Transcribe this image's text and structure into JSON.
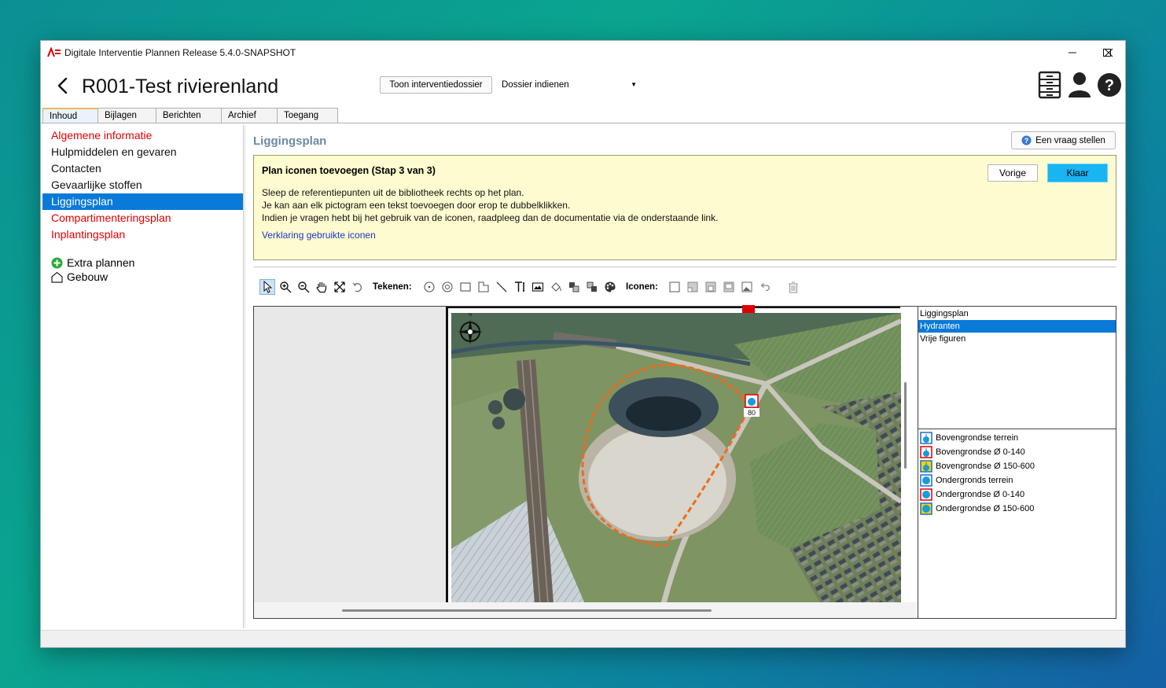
{
  "window": {
    "title": "Digitale Interventie Plannen Release 5.4.0-SNAPSHOT",
    "controls": [
      "minimize-icon",
      "maximize-icon",
      "close-icon"
    ]
  },
  "header": {
    "dossier_title": "R001-Test rivierenland",
    "toon_button": "Toon interventiedossier",
    "dossier_select": {
      "selected": "Dossier indienen"
    },
    "icons": [
      "cabinet-icon",
      "user-icon",
      "help-icon"
    ]
  },
  "tabs": [
    "Inhoud",
    "Bijlagen",
    "Berichten",
    "Archief",
    "Toegang"
  ],
  "active_tab": "Inhoud",
  "sidebar": {
    "items": [
      {
        "label": "Algemene informatie",
        "state": "incomplete"
      },
      {
        "label": "Hulpmiddelen en gevaren",
        "state": "complete"
      },
      {
        "label": "Contacten",
        "state": "complete"
      },
      {
        "label": "Gevaarlijke stoffen",
        "state": "complete"
      },
      {
        "label": "Liggingsplan",
        "state": "active"
      },
      {
        "label": "Compartimenteringsplan",
        "state": "incomplete"
      },
      {
        "label": "Inplantingsplan",
        "state": "incomplete"
      }
    ],
    "extra_plans": "Extra plannen",
    "building": "Gebouw"
  },
  "main": {
    "section_title": "Liggingsplan",
    "ask_button": "Een vraag stellen",
    "step": {
      "title": "Plan iconen toevoegen (Stap 3 van 3)",
      "lines": [
        "Sleep de referentiepunten uit de bibliotheek rechts op het plan.",
        "Je kan aan elk pictogram een tekst toevoegen door erop te dubbelklikken.",
        "Indien je vragen hebt bij het gebruik van de iconen, raadpleeg dan de documentatie via de onderstaande link."
      ],
      "link": "Verklaring gebruikte iconen",
      "prev_button": "Vorige",
      "done_button": "Klaar"
    },
    "toolbar": {
      "draw_label": "Tekenen:",
      "icons_label": "Iconen:"
    },
    "map": {
      "marker_label": "80",
      "north_label": "N"
    },
    "library": {
      "categories": [
        "Liggingsplan",
        "Hydranten",
        "Vrije figuren"
      ],
      "selected_category": "Hydranten",
      "icons": [
        {
          "label": "Bovengrondse terrein",
          "border": "#1a6fd0",
          "fill": "#ffffff"
        },
        {
          "label": "Bovengrondse Ø 0-140",
          "border": "#e00000",
          "fill": "#ffffff"
        },
        {
          "label": "Bovengrondse Ø 150-600",
          "border": "#1a6fd0",
          "fill": "#f5d400"
        },
        {
          "label": "Ondergronds terrein",
          "border": "#1a6fd0",
          "fill": "#ffffff"
        },
        {
          "label": "Ondergrondse Ø 0-140",
          "border": "#e00000",
          "fill": "#ffffff"
        },
        {
          "label": "Ondergrondse Ø 150-600",
          "border": "#1a6fd0",
          "fill": "#f5d400"
        }
      ]
    }
  },
  "colors": {
    "accent": "#0a7ad8",
    "incomplete": "#e00000",
    "step_bg": "#fdfbcf",
    "primary_button": "#19b4f2",
    "route": "#f06a1a"
  }
}
